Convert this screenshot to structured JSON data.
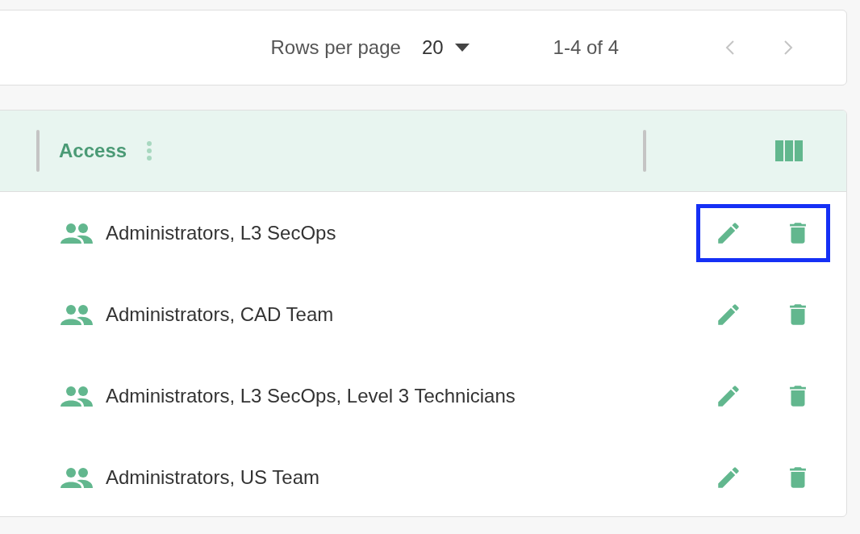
{
  "pagination": {
    "rows_per_page_label": "Rows per page",
    "rows_per_page": "20",
    "range": "1-4 of 4",
    "prev_disabled": true,
    "next_disabled": true
  },
  "table": {
    "columns": [
      {
        "label": "Access"
      }
    ],
    "rows": [
      {
        "access": "Administrators, L3 SecOps",
        "highlighted": true
      },
      {
        "access": "Administrators, CAD Team",
        "highlighted": false
      },
      {
        "access": "Administrators, L3 SecOps, Level 3 Technicians",
        "highlighted": false
      },
      {
        "access": "Administrators, US Team",
        "highlighted": false
      }
    ]
  }
}
